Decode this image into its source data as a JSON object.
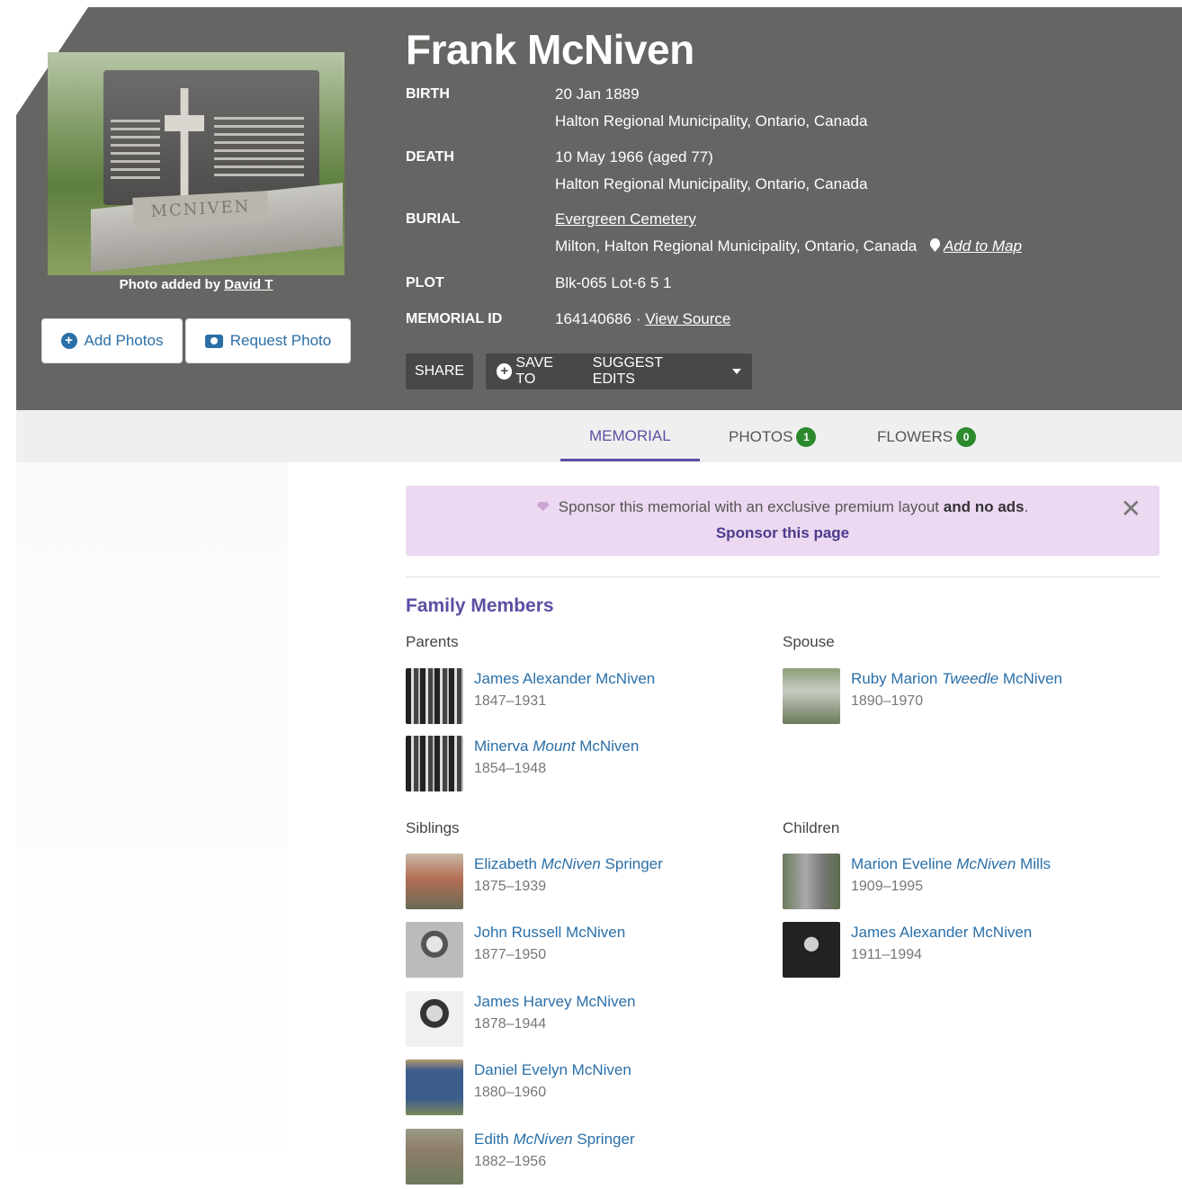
{
  "person": {
    "name": "Frank McNiven",
    "photo_credit_prefix": "Photo added by",
    "photo_credit_user": "David T",
    "stone_text": "MCNIVEN"
  },
  "buttons": {
    "add_photos": "Add Photos",
    "request_photo": "Request Photo",
    "share": "SHARE",
    "save_to": "SAVE TO",
    "suggest_edits": "SUGGEST EDITS"
  },
  "facts": {
    "birth_label": "BIRTH",
    "birth_date": "20 Jan 1889",
    "birth_place": "Halton Regional Municipality, Ontario, Canada",
    "death_label": "DEATH",
    "death_date": "10 May 1966 (aged 77)",
    "death_place": "Halton Regional Municipality, Ontario, Canada",
    "burial_label": "BURIAL",
    "burial_cemetery": "Evergreen Cemetery",
    "burial_place": "Milton, Halton Regional Municipality, Ontario, Canada",
    "add_to_map": "Add to Map",
    "plot_label": "PLOT",
    "plot_value": "Blk-065 Lot-6 5 1",
    "memorial_label": "MEMORIAL ID",
    "memorial_id": "164140686 ·",
    "view_source": "View Source"
  },
  "tabs": {
    "memorial": "MEMORIAL",
    "photos": "PHOTOS",
    "photos_count": "1",
    "flowers": "FLOWERS",
    "flowers_count": "0"
  },
  "sponsor": {
    "text": "Sponsor this memorial with an exclusive premium layout",
    "bold": "and no ads",
    "period": ".",
    "link": "Sponsor this page"
  },
  "family": {
    "title": "Family Members",
    "parents_label": "Parents",
    "spouse_label": "Spouse",
    "siblings_label": "Siblings",
    "children_label": "Children",
    "parents": [
      {
        "first": "James Alexander McNiven",
        "maiden": "",
        "last": "",
        "dates": "1847–1931"
      },
      {
        "first": "Minerva",
        "maiden": "Mount",
        "last": "McNiven",
        "dates": "1854–1948"
      }
    ],
    "spouse": [
      {
        "first": "Ruby Marion",
        "maiden": "Tweedle",
        "last": "McNiven",
        "dates": "1890–1970"
      }
    ],
    "siblings": [
      {
        "first": "Elizabeth",
        "maiden": "McNiven",
        "last": "Springer",
        "dates": "1875–1939"
      },
      {
        "first": "John Russell McNiven",
        "maiden": "",
        "last": "",
        "dates": "1877–1950"
      },
      {
        "first": "James Harvey McNiven",
        "maiden": "",
        "last": "",
        "dates": "1878–1944"
      },
      {
        "first": "Daniel Evelyn McNiven",
        "maiden": "",
        "last": "",
        "dates": "1880–1960"
      },
      {
        "first": "Edith",
        "maiden": "McNiven",
        "last": "Springer",
        "dates": "1882–1956"
      }
    ],
    "children": [
      {
        "first": "Marion Eveline",
        "maiden": "McNiven",
        "last": "Mills",
        "dates": "1909–1995"
      },
      {
        "first": "James Alexander McNiven",
        "maiden": "",
        "last": "",
        "dates": "1911–1994"
      }
    ]
  }
}
